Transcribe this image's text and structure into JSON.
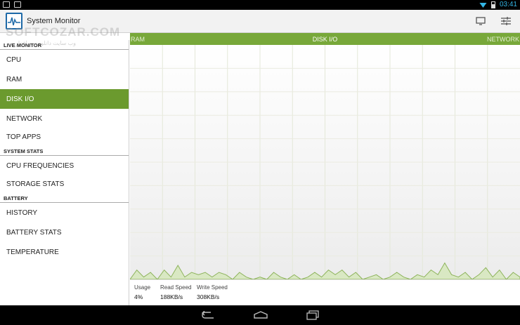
{
  "app": {
    "title": "System Monitor",
    "accent": "#6b9a2e"
  },
  "status_bar": {
    "time": "03:41"
  },
  "watermark": {
    "text": "SOFTCOZAR.COM",
    "sub": "وب سایت دانلود نرم افزار"
  },
  "sidebar": {
    "sections": [
      {
        "header": "LIVE MONITOR",
        "items": [
          "CPU",
          "RAM",
          "DISK I/O",
          "NETWORK",
          "TOP APPS"
        ]
      },
      {
        "header": "SYSTEM STATS",
        "items": [
          "CPU FREQUENCIES",
          "STORAGE STATS"
        ]
      },
      {
        "header": "BATTERY",
        "items": [
          "HISTORY",
          "BATTERY STATS",
          "TEMPERATURE"
        ]
      }
    ],
    "active": "DISK I/O"
  },
  "tabs": {
    "left": "RAM",
    "center": "DISK I/O",
    "right": "NETWORK"
  },
  "stats": {
    "usage": {
      "label": "Usage",
      "value": "4%"
    },
    "read": {
      "label": "Read Speed",
      "value": "188KB/s"
    },
    "write": {
      "label": "Write Speed",
      "value": "308KB/s"
    }
  },
  "chart_data": {
    "type": "area",
    "title": "",
    "xlabel": "",
    "ylabel": "",
    "ylim": [
      0,
      100
    ],
    "grid": true,
    "series": [
      {
        "values": [
          0,
          4,
          1,
          3,
          0,
          4,
          1,
          6,
          1,
          3,
          2,
          3,
          1,
          3,
          2,
          0,
          3,
          1,
          0,
          1,
          0,
          3,
          1,
          0,
          2,
          0,
          1,
          3,
          1,
          4,
          2,
          4,
          1,
          3,
          0,
          1,
          2,
          0,
          1,
          3,
          1,
          0,
          2,
          1,
          4,
          2,
          7,
          2,
          1,
          3,
          0,
          2,
          5,
          1,
          4,
          0,
          3,
          1
        ]
      }
    ]
  }
}
